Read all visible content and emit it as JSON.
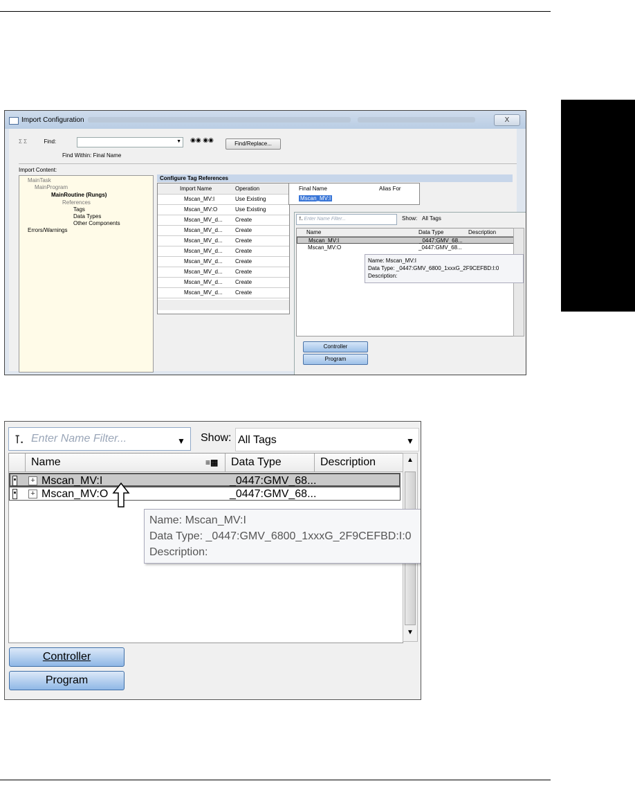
{
  "screenshot1": {
    "window_title": "Import Configuration",
    "close_label": "X",
    "find_label": "Find:",
    "find_within": "Find Within: Final Name",
    "find_replace_label": "Find/Replace...",
    "import_content_label": "Import Content:",
    "tree": [
      "MainTask",
      "MainProgram",
      "MainRoutine (Rungs)",
      "References",
      "Tags",
      "Data Types",
      "Other Components",
      "Errors/Warnings"
    ],
    "configure_title": "Configure Tag References",
    "grid_headers": [
      "Import Name",
      "Operation"
    ],
    "final_name_header": "Final Name",
    "alias_header": "Alias For",
    "final_name_value": "Mscan_MV:I",
    "rows": [
      [
        "Mscan_MV:I",
        "Use Existing"
      ],
      [
        "Mscan_MV:O",
        "Use Existing"
      ],
      [
        "Mscan_MV_d...",
        "Create"
      ],
      [
        "Mscan_MV_d...",
        "Create"
      ],
      [
        "Mscan_MV_d...",
        "Create"
      ],
      [
        "Mscan_MV_d...",
        "Create"
      ],
      [
        "Mscan_MV_d...",
        "Create"
      ],
      [
        "Mscan_MV_d...",
        "Create"
      ],
      [
        "Mscan_MV_d...",
        "Create"
      ],
      [
        "Mscan_MV_d...",
        "Create"
      ]
    ],
    "popup": {
      "filter_placeholder": "Enter Name Filter...",
      "show_label": "Show:",
      "show_value": "All Tags",
      "headers": [
        "Name",
        "Data Type",
        "Description"
      ],
      "tags": [
        {
          "name": "Mscan_MV:I",
          "type": "_0447:GMV_68..."
        },
        {
          "name": "Mscan_MV:O",
          "type": "_0447:GMV_68..."
        }
      ],
      "controller_label": "Controller",
      "program_label": "Program"
    },
    "tooltip": {
      "name": "Name: Mscan_MV:I",
      "data_type": "Data Type: _0447:GMV_6800_1xxxG_2F9CEFBD:I:0",
      "description": "Description:"
    }
  },
  "screenshot2": {
    "filter_placeholder": "Enter Name Filter...",
    "show_label": "Show:",
    "show_value": "All Tags",
    "headers": {
      "name": "Name",
      "data_type": "Data Type",
      "description": "Description"
    },
    "tags": [
      {
        "name": "Mscan_MV:I",
        "type": "_0447:GMV_68..."
      },
      {
        "name": "Mscan_MV:O",
        "type": "_0447:GMV_68..."
      }
    ],
    "tooltip": {
      "name": "Name: Mscan_MV:I",
      "data_type": "Data Type: _0447:GMV_6800_1xxxG_2F9CEFBD:I:0",
      "description": "Description:"
    },
    "controller_label": "Controller",
    "program_label": "Program"
  }
}
